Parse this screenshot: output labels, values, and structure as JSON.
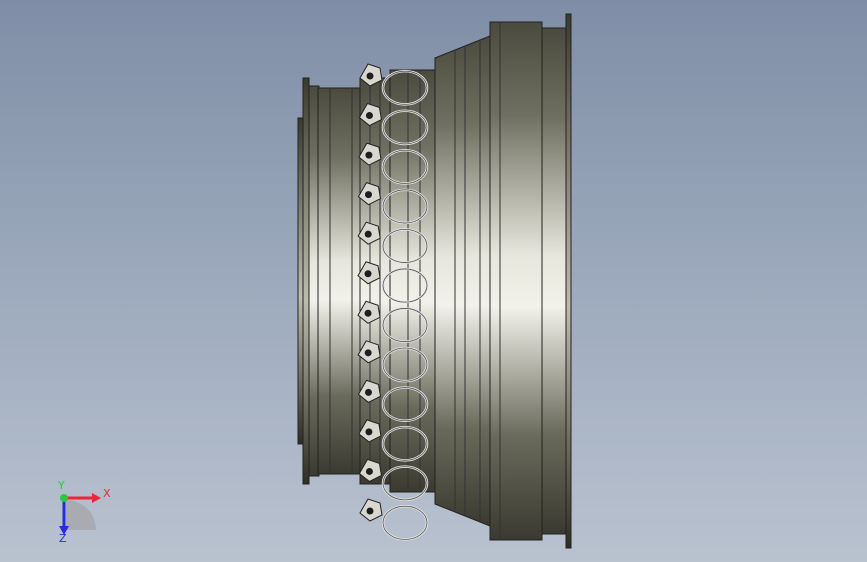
{
  "viewport": {
    "background_top": "#7f8ea6",
    "background_bottom": "#b9c2cf"
  },
  "model": {
    "part": "engine-casing-assembly",
    "bracket_count": 12
  },
  "triad": {
    "x_label": "X",
    "y_label": "Y",
    "z_label": "Z",
    "x_color": "#e8283a",
    "y_color": "#27c93f",
    "z_color": "#2a2ae0"
  }
}
